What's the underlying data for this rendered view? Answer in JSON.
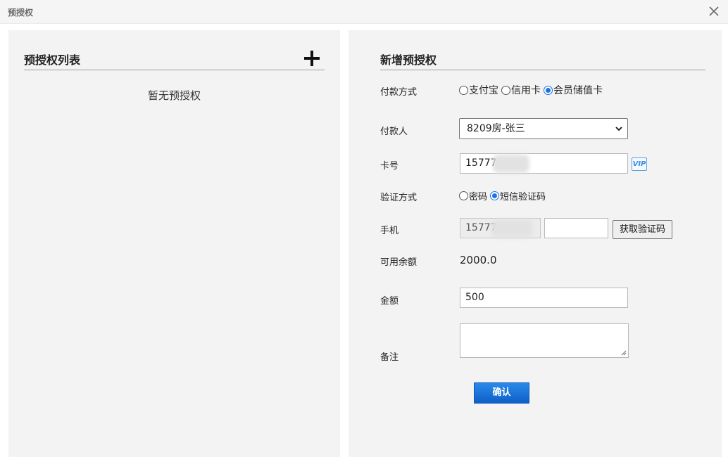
{
  "window": {
    "title": "预授权",
    "close_icon": "close-icon"
  },
  "left": {
    "title": "预授权列表",
    "add_icon": "plus-icon",
    "empty_text": "暂无预授权"
  },
  "right": {
    "title": "新增预授权",
    "payment_method": {
      "label": "付款方式",
      "options": [
        "支付宝",
        "信用卡",
        "会员储值卡"
      ],
      "selected": "会员储值卡"
    },
    "payer": {
      "label": "付款人",
      "value": "8209房-张三"
    },
    "card": {
      "label": "卡号",
      "value": "15777",
      "badge": "VIP"
    },
    "verify_method": {
      "label": "验证方式",
      "options": [
        "密码",
        "短信验证码"
      ],
      "selected": "短信验证码"
    },
    "phone": {
      "label": "手机",
      "value": "15777",
      "code_value": "",
      "send_code_label": "获取验证码"
    },
    "balance": {
      "label": "可用余额",
      "value": "2000.0"
    },
    "amount": {
      "label": "金额",
      "value": "500"
    },
    "remark": {
      "label": "备注",
      "value": ""
    },
    "confirm_label": "确认"
  },
  "colors": {
    "accent": "#1a73e8",
    "panel_bg": "#f3f3f3",
    "button_primary": "#1565d4"
  }
}
